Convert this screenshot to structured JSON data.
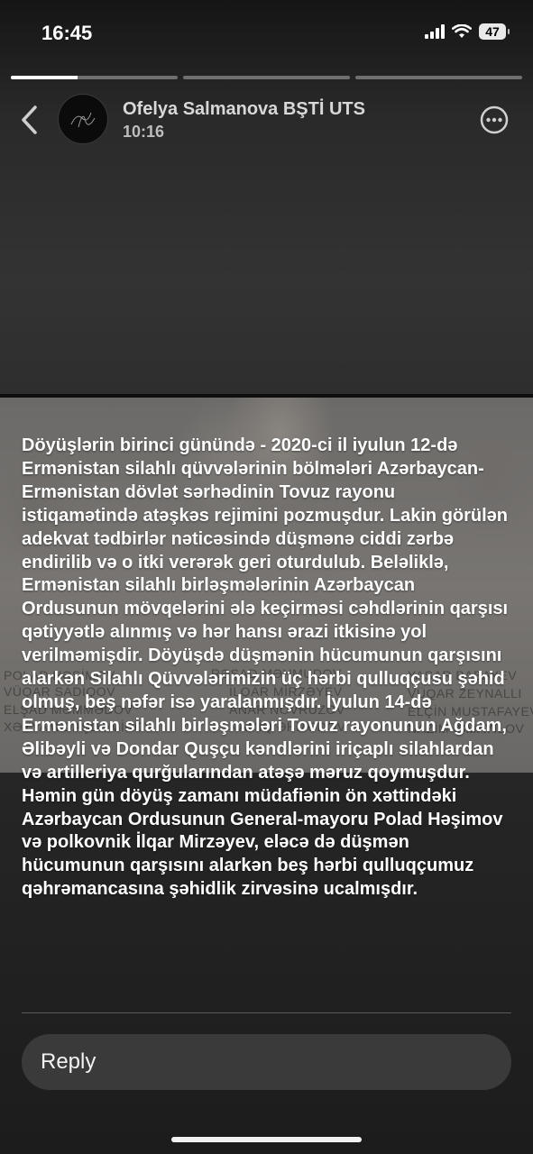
{
  "status_bar": {
    "time": "16:45",
    "battery": "47"
  },
  "story": {
    "progress": [
      0.4,
      0,
      0
    ],
    "sender": "Ofelya Salmanova BŞTİ UTS",
    "time": "10:16",
    "photo_captions": [
      "POLAD HƏŞİMOV",
      "VÜQAR SADIQOV",
      "ELŞAD MƏMMƏDOV",
      "XƏYYAM DAŞDƏMİROV",
      "RƏŞAD MƏHMUDOV",
      "İLQAR MİRZƏYEV",
      "ANAR NOVRUZOV",
      "NAMİQ ƏHMƏDOV",
      "YAŞAR BABAYEV",
      "VÜQAR ZEYNALLI",
      "ELÇİN MUSTAFAYEVİ",
      "NAZİM İSMAYILOV"
    ],
    "message": "Döyüşlərin birinci günündə - 2020-ci il iyulun 12-də Ermənistan silahlı qüvvələrinin bölmələri Azərbaycan-Ermənistan dövlət sərhədinin Tovuz rayonu istiqamətində atəşkəs rejimini pozmuşdur. Lakin görülən adekvat tədbirlər nəticəsində düşmənə ciddi zərbə endirilib və o itki verərək geri oturdulub. Beləliklə, Ermənistan silahlı birləşmələrinin Azərbaycan Ordusunun mövqelərini ələ keçirməsi cəhdlərinin qarşısı qətiyyətlə alınmış və hər hansı ərazi itkisinə yol verilməmişdir. Döyüşdə düşmənin hücumunun qarşısını alarkən Silahlı Qüvvələrimizin üç hərbi qulluqçusu şəhid olmuş, beş nəfər isə yaralanmışdır. İyulun 14-də Ermənistan silahlı birləşmələri Tovuz rayonunun Ağdam, Əlibəyli və Dondar Quşçu kəndlərini iriçaplı silahlardan və artilleriya qurğularından atəşə məruz qoymuşdur. Həmin gün döyüş zamanı müdafiənin ön xəttindəki Azərbaycan Ordusunun General-mayoru Polad Həşimov və polkovnik İlqar Mirzəyev, eləcə də düşmən hücumunun qarşısını alarkən beş hərbi qulluqçumuz qəhrəmancasına şəhidlik zirvəsinə ucalmışdır.",
    "reply_label": "Reply"
  },
  "icons": {
    "back": "chevron-left-icon",
    "more": "ellipsis-circle-icon",
    "signal": "cellular-signal-icon",
    "wifi": "wifi-icon",
    "battery": "battery-icon"
  }
}
